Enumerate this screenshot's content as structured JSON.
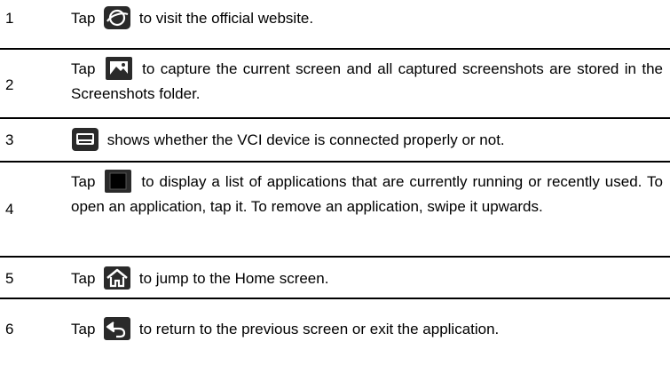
{
  "rows": [
    {
      "num": "1",
      "before": "Tap",
      "icon": "globe-icon",
      "after": "to visit the official website."
    },
    {
      "num": "2",
      "before": "Tap",
      "icon": "screenshot-icon",
      "after": "to capture the current screen and all captured screenshots are stored in the Screenshots folder."
    },
    {
      "num": "3",
      "before": "",
      "icon": "vci-device-icon",
      "after": "shows whether the VCI device is connected properly or not."
    },
    {
      "num": "4",
      "before": "Tap",
      "icon": "recent-apps-icon",
      "after": "to display a list of applications that are currently running or recently used. To open an application, tap it. To remove an application, swipe it upwards."
    },
    {
      "num": "5",
      "before": "Tap",
      "icon": "home-icon",
      "after": "to jump to the Home screen."
    },
    {
      "num": "6",
      "before": "Tap",
      "icon": "back-icon",
      "after": "to return to the previous screen or exit the application."
    }
  ]
}
